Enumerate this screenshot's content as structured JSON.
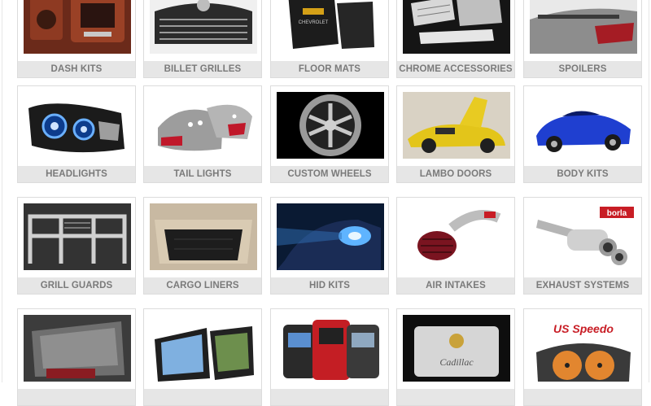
{
  "categories": [
    {
      "label": "DASH KITS",
      "icon": "dash-kit-photo"
    },
    {
      "label": "BILLET GRILLES",
      "icon": "billet-grille-photo"
    },
    {
      "label": "FLOOR MATS",
      "icon": "floor-mat-photo"
    },
    {
      "label": "CHROME ACCESSORIES",
      "icon": "chrome-accessories-photo"
    },
    {
      "label": "SPOILERS",
      "icon": "spoiler-photo"
    },
    {
      "label": "HEADLIGHTS",
      "icon": "headlight-photo"
    },
    {
      "label": "TAIL LIGHTS",
      "icon": "tail-light-photo"
    },
    {
      "label": "CUSTOM WHEELS",
      "icon": "custom-wheel-photo"
    },
    {
      "label": "LAMBO DOORS",
      "icon": "lambo-door-photo"
    },
    {
      "label": "BODY KITS",
      "icon": "body-kit-photo"
    },
    {
      "label": "GRILL GUARDS",
      "icon": "grill-guard-photo"
    },
    {
      "label": "CARGO LINERS",
      "icon": "cargo-liner-photo"
    },
    {
      "label": "HID KITS",
      "icon": "hid-kit-photo"
    },
    {
      "label": "AIR INTAKES",
      "icon": "air-intake-photo"
    },
    {
      "label": "EXHAUST SYSTEMS",
      "icon": "exhaust-system-photo"
    },
    {
      "label": "",
      "icon": "window-visor-photo"
    },
    {
      "label": "",
      "icon": "gps-navigation-photo"
    },
    {
      "label": "",
      "icon": "performance-tuner-photo"
    },
    {
      "label": "",
      "icon": "license-plate-photo"
    },
    {
      "label": "",
      "icon": "gauge-cluster-photo"
    }
  ],
  "brand_marks": {
    "floor_mat_logo": "CHEVROLET",
    "exhaust_logo": "borla",
    "license_plate_text": "Cadillac",
    "gauge_logo": "US Speedo"
  }
}
